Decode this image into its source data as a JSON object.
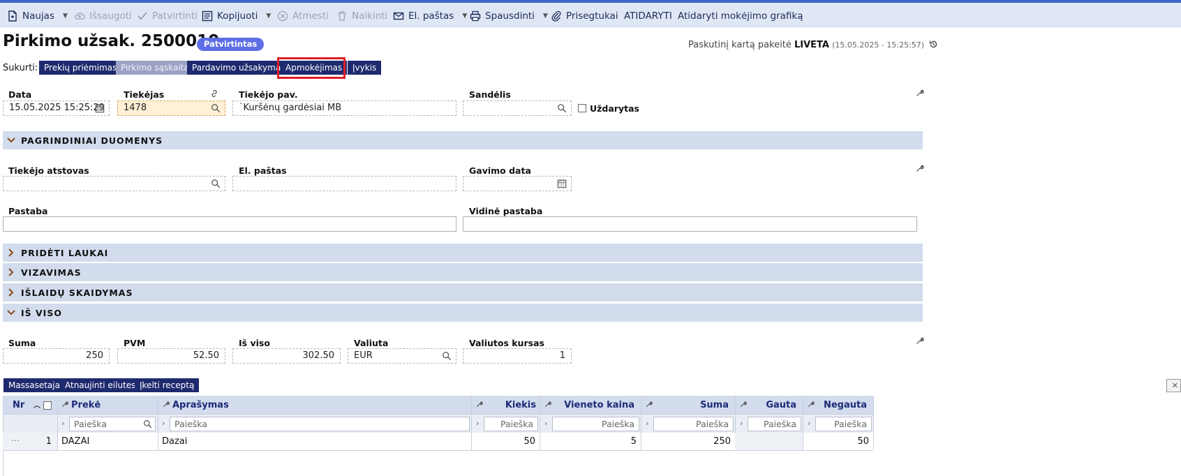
{
  "toolbar": {
    "items": [
      {
        "label": "Naujas",
        "icon": "new-document-icon",
        "caret": true,
        "disabled": false
      },
      {
        "label": "Išsaugoti",
        "icon": "cloud-save-icon",
        "caret": false,
        "disabled": true
      },
      {
        "label": "Patvirtinti",
        "icon": "check-icon",
        "caret": false,
        "disabled": true
      },
      {
        "label": "Kopijuoti",
        "icon": "copy-icon",
        "caret": true,
        "disabled": false
      },
      {
        "label": "Atmesti",
        "icon": "cancel-circle-icon",
        "caret": false,
        "disabled": true
      },
      {
        "label": "Naikinti",
        "icon": "trash-icon",
        "caret": false,
        "disabled": true
      },
      {
        "label": "El. paštas",
        "icon": "envelope-icon",
        "caret": true,
        "disabled": false
      },
      {
        "label": "Spausdinti",
        "icon": "printer-icon",
        "caret": true,
        "disabled": false
      },
      {
        "label": "Prisegtukai",
        "icon": "paperclip-icon",
        "caret": false,
        "disabled": false
      },
      {
        "label": "ATIDARYTI",
        "icon": "",
        "caret": false,
        "disabled": false
      },
      {
        "label": "Atidaryti mokėjimo grafiką",
        "icon": "",
        "caret": false,
        "disabled": false
      }
    ]
  },
  "header": {
    "title": "Pirkimo užsak. 2500010",
    "status_badge": "Patvirtintas",
    "last_modified_prefix": "Paskutinį kartą pakeitė",
    "last_modified_user": "LIVETA",
    "last_modified_time": "(15.05.2025 - 15:25:57)"
  },
  "create": {
    "label": "Sukurti:",
    "buttons": [
      "Prekių priėmimas",
      "Pirkimo sąskaita",
      "Pardavimo užsakymas",
      "Apmokėjimas",
      "Įvykis"
    ]
  },
  "fields": {
    "data_label": "Data",
    "data_value": "15.05.2025 15:25:29",
    "tiekejas_label": "Tiekėjas",
    "tiekejas_value": "1478",
    "tiekejo_pav_label": "Tiekėjo pav.",
    "tiekejo_pav_value": "˙Kuršėnų gardėsiai MB",
    "sandelis_label": "Sandėlis",
    "sandelis_value": "",
    "uzdarytas_label": "Uždarytas"
  },
  "sections": {
    "pagrindiniai": "PAGRINDINIAI DUOMENYS",
    "prideti": "PRIDĖTI LAUKAI",
    "vizavimas": "VIZAVIMAS",
    "islaidu": "IŠLAIDŲ SKAIDYMAS",
    "is_viso": "IŠ VISO"
  },
  "main": {
    "atstovas_label": "Tiekėjo atstovas",
    "email_label": "El. paštas",
    "gavimo_label": "Gavimo data",
    "pastaba_label": "Pastaba",
    "vidine_label": "Vidinė pastaba"
  },
  "totals": {
    "suma_label": "Suma",
    "suma_value": "250",
    "pvm_label": "PVM",
    "pvm_value": "52.50",
    "isviso_label": "Iš viso",
    "isviso_value": "302.50",
    "valiuta_label": "Valiuta",
    "valiuta_value": "EUR",
    "kursas_label": "Valiutos kursas",
    "kursas_value": "1"
  },
  "grid_buttons": [
    "Massasetaja",
    "Atnaujinti eilutes",
    "Įkelti receptą"
  ],
  "grid": {
    "columns": [
      "Nr",
      "Prekė",
      "Aprašymas",
      "Kiekis",
      "Vieneto kaina",
      "Suma",
      "Gauta",
      "Negauta"
    ],
    "search_placeholder": "Paieška",
    "row": {
      "nr": "1",
      "dots": "···",
      "preke": "DAZAI",
      "aprasymas": "Dazai",
      "kiekis": "50",
      "kaina": "5",
      "suma": "250",
      "gauta": "",
      "negauta": "50"
    }
  },
  "colors": {
    "accent": "#1e2a6e",
    "toolbar": "#dfe7f5",
    "section": "#d2dced",
    "highlight": "#e01f26",
    "badge": "#5d6ee6"
  }
}
